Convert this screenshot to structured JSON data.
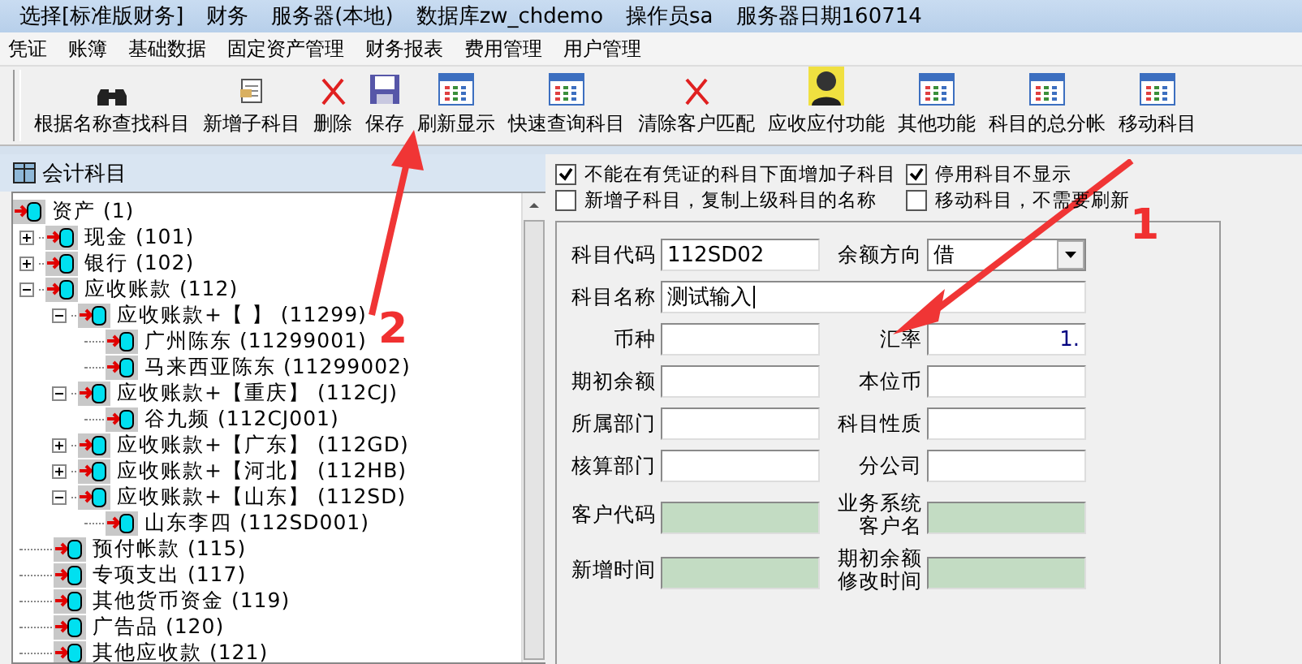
{
  "title_bar": [
    "选择[标准版财务]",
    "财务",
    "服务器(本地)",
    "数据库zw_chdemo",
    "操作员sa",
    "服务器日期160714"
  ],
  "menu": [
    "凭证",
    "账簿",
    "基础数据",
    "固定资产管理",
    "财务报表",
    "费用管理",
    "用户管理"
  ],
  "toolbar": [
    {
      "label": "根据名称查找科目",
      "kind": "binoculars"
    },
    {
      "label": "新增子科目",
      "kind": "document"
    },
    {
      "label": "删除",
      "kind": "cross"
    },
    {
      "label": "保存",
      "kind": "floppy"
    },
    {
      "label": "刷新显示",
      "kind": "grid"
    },
    {
      "label": "快速查询科目",
      "kind": "grid"
    },
    {
      "label": "清除客户匹配",
      "kind": "cross"
    },
    {
      "label": "应收应付功能",
      "kind": "person"
    },
    {
      "label": "其他功能",
      "kind": "grid"
    },
    {
      "label": "科目的总分帐",
      "kind": "grid"
    },
    {
      "label": "移动科目",
      "kind": "grid"
    }
  ],
  "panel": {
    "title": "会计科目"
  },
  "tree": [
    {
      "label": "资产 (1)",
      "children": [
        {
          "label": "现金 (101)",
          "expanded": false
        },
        {
          "label": "银行 (102)",
          "expanded": false
        },
        {
          "label": "应收账款 (112)",
          "expanded": true,
          "children": [
            {
              "label": "应收账款+【 】 (11299)",
              "expanded": true,
              "children": [
                {
                  "label": "广州陈东 (11299001)"
                },
                {
                  "label": "马来西亚陈东 (11299002)"
                }
              ]
            },
            {
              "label": "应收账款+【重庆】 (112CJ)",
              "expanded": true,
              "children": [
                {
                  "label": "谷九频 (112CJ001)"
                }
              ]
            },
            {
              "label": "应收账款+【广东】 (112GD)",
              "expanded": false
            },
            {
              "label": "应收账款+【河北】 (112HB)",
              "expanded": false
            },
            {
              "label": "应收账款+【山东】 (112SD)",
              "expanded": true,
              "children": [
                {
                  "label": "山东李四 (112SD001)"
                }
              ]
            }
          ]
        },
        {
          "label": "预付帐款 (115)"
        },
        {
          "label": "专项支出 (117)"
        },
        {
          "label": "其他货币资金 (119)"
        },
        {
          "label": "广告品 (120)"
        },
        {
          "label": "其他应收款 (121)"
        }
      ]
    }
  ],
  "options": [
    {
      "label": "不能在有凭证的科目下面增加子科目",
      "checked": true
    },
    {
      "label": "停用科目不显示",
      "checked": true
    },
    {
      "label": "新增子科目，复制上级科目的名称",
      "checked": false
    },
    {
      "label": "移动科目，不需要刷新",
      "checked": false
    }
  ],
  "form": {
    "code": {
      "label": "科目代码",
      "value": "112SD02"
    },
    "direction": {
      "label": "余额方向",
      "value": "借"
    },
    "name": {
      "label": "科目名称",
      "value": "测试输入"
    },
    "fields": [
      {
        "label": "币种",
        "readonly": false
      },
      {
        "label": "汇率",
        "value": "1.",
        "readonly": false
      },
      {
        "label": "期初余额",
        "readonly": false
      },
      {
        "label": "本位币",
        "readonly": false
      },
      {
        "label": "所属部门",
        "readonly": false
      },
      {
        "label": "科目性质",
        "readonly": false
      },
      {
        "label": "核算部门",
        "readonly": false
      },
      {
        "label": "分公司",
        "readonly": false
      },
      {
        "label": "客户代码",
        "readonly": true
      },
      {
        "label": "业务系统客户名",
        "readonly": true
      },
      {
        "label": "新增时间",
        "readonly": true
      },
      {
        "label": "期初余额修改时间",
        "readonly": true
      }
    ]
  },
  "annotations": [
    {
      "label": "1"
    },
    {
      "label": "2"
    }
  ]
}
